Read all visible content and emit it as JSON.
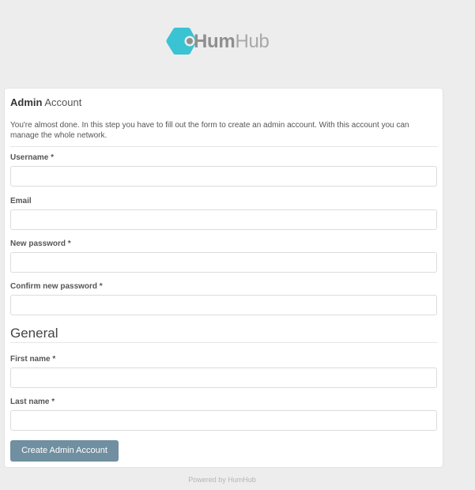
{
  "brand": {
    "logo_icon": "humhub-hexagon-icon",
    "name_bold": "Hum",
    "name_light": "Hub",
    "accent": "#3ac3d2"
  },
  "panel": {
    "title_bold": "Admin",
    "title_light": "Account",
    "intro": "You're almost done. In this step you have to fill out the form to create an admin account. With this account you can manage the whole network."
  },
  "fields": {
    "username": {
      "label": "Username *",
      "value": ""
    },
    "email": {
      "label": "Email",
      "value": ""
    },
    "new_password": {
      "label": "New password *",
      "value": ""
    },
    "confirm_password": {
      "label": "Confirm new password *",
      "value": ""
    },
    "first_name": {
      "label": "First name *",
      "value": ""
    },
    "last_name": {
      "label": "Last name *",
      "value": ""
    }
  },
  "general_section": {
    "title": "General"
  },
  "submit": {
    "label": "Create Admin Account",
    "color": "#708fa0"
  },
  "footer": {
    "text": "Powered by HumHub"
  }
}
